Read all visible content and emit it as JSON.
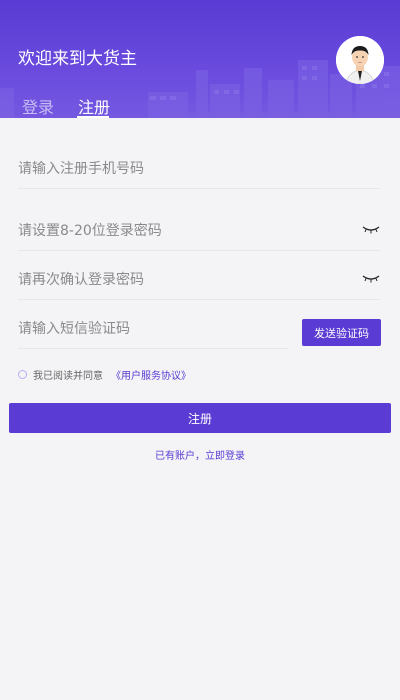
{
  "header": {
    "welcome": "欢迎来到大货主",
    "tabs": [
      {
        "label": "登录",
        "active": false
      },
      {
        "label": "注册",
        "active": true
      }
    ]
  },
  "form": {
    "phone_placeholder": "请输入注册手机号码",
    "password_placeholder": "请设置8-20位登录密码",
    "confirm_placeholder": "请再次确认登录密码",
    "sms_placeholder": "请输入短信验证码",
    "send_code_label": "发送验证码",
    "agree_text": "我已阅读并同意",
    "agreement_link": "《用户服务协议》",
    "submit_label": "注册",
    "login_link": "已有账户，立即登录"
  },
  "colors": {
    "primary": "#5a3bd3",
    "background": "#f4f4f6"
  }
}
